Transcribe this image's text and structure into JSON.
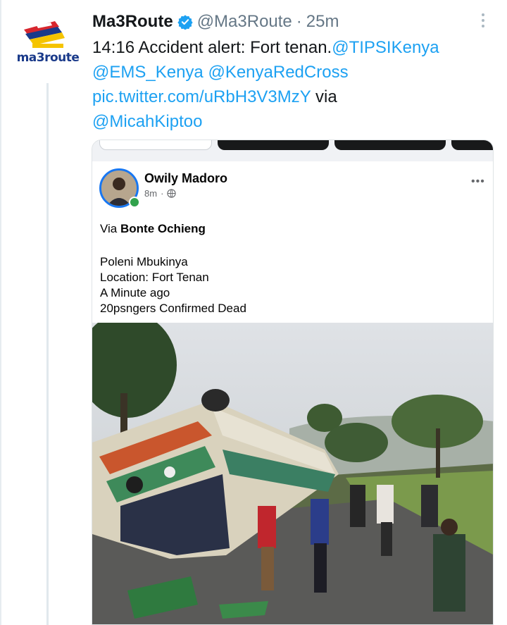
{
  "tweet": {
    "display_name": "Ma3Route",
    "handle": "@Ma3Route",
    "separator": "·",
    "time": "25m",
    "logo_text": "ma3route",
    "text_lines": [
      [
        {
          "t": "14:16 Accident alert: Fort tenan.",
          "link": false
        },
        {
          "t": "@TIPSIKenya",
          "link": true
        }
      ],
      [
        {
          "t": "@EMS_Kenya",
          "link": true
        },
        {
          "t": " ",
          "link": false
        },
        {
          "t": "@KenyaRedCross",
          "link": true
        }
      ],
      [
        {
          "t": "pic.twitter.com/uRbH3V3MzY",
          "link": true
        },
        {
          "t": " via",
          "link": false
        }
      ],
      [
        {
          "t": "@MicahKiptoo",
          "link": true
        }
      ]
    ]
  },
  "fb_post": {
    "author": "Owily Madoro",
    "time": "8m",
    "separator": "·",
    "via_prefix": "Via ",
    "via_name": "Bonte Ochieng",
    "body_lines": [
      "Poleni Mbukinya",
      "Location: Fort Tenan",
      "A Minute ago",
      "20psngers Confirmed Dead"
    ],
    "more": "•••"
  },
  "colors": {
    "link": "#1da1f2",
    "verified": "#1da1f2",
    "fb_ring": "#1877f2",
    "fb_online": "#31a24c"
  },
  "icons": [
    "verified-badge-icon",
    "more-vertical-icon",
    "globe-icon",
    "more-horizontal-icon"
  ]
}
